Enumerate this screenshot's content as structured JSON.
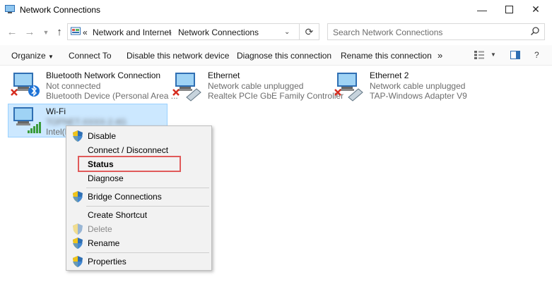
{
  "window": {
    "title": "Network Connections"
  },
  "address": {
    "prefix": "«",
    "crumbs": [
      "Network and Internet",
      "Network Connections"
    ]
  },
  "search": {
    "placeholder": "Search Network Connections"
  },
  "commands": {
    "organize": "Organize",
    "connect_to": "Connect To",
    "disable": "Disable this network device",
    "diagnose": "Diagnose this connection",
    "rename": "Rename this connection",
    "more": "»"
  },
  "connections": [
    {
      "name": "Bluetooth Network Connection",
      "status": "Not connected",
      "device": "Bluetooth Device (Personal Area ...",
      "icon": "bluetooth-adapter-icon"
    },
    {
      "name": "Ethernet",
      "status": "Network cable unplugged",
      "device": "Realtek PCIe GbE Family Controller",
      "icon": "ethernet-adapter-icon"
    },
    {
      "name": "Ethernet 2",
      "status": "Network cable unplugged",
      "device": "TAP-Windows Adapter V9",
      "icon": "ethernet-adapter-icon"
    },
    {
      "name": "Wi-Fi",
      "status": "TOPNET-XXXX-2.4G",
      "device": "Intel(R)",
      "icon": "wifi-adapter-icon"
    }
  ],
  "context_menu": [
    {
      "label": "Disable",
      "shield": true
    },
    {
      "label": "Connect / Disconnect",
      "shield": false
    },
    {
      "label": "Status",
      "shield": false,
      "bold": true
    },
    {
      "label": "Diagnose",
      "shield": false
    },
    {
      "label": "Bridge Connections",
      "shield": true
    },
    {
      "label": "Create Shortcut",
      "shield": false
    },
    {
      "label": "Delete",
      "shield": true,
      "disabled": true
    },
    {
      "label": "Rename",
      "shield": true
    },
    {
      "label": "Properties",
      "shield": true
    }
  ],
  "colors": {
    "highlight_box": "#e05a5a",
    "selection": "#cce8ff"
  }
}
